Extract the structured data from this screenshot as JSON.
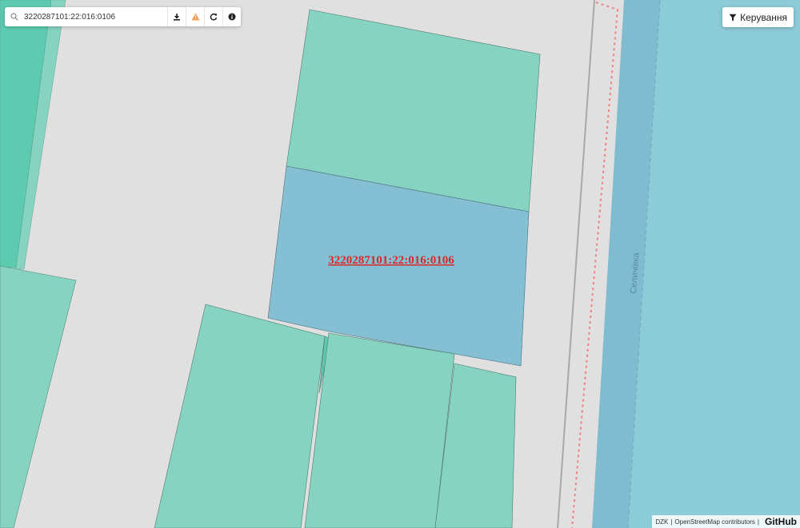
{
  "search": {
    "value": "3220287101:22:016:0106",
    "placeholder": ""
  },
  "toolbar": {
    "download_icon": "download-icon",
    "warning_icon": "warning-icon",
    "refresh_icon": "refresh-icon",
    "info_icon": "info-icon"
  },
  "control": {
    "label": "Керування",
    "icon": "filter-icon"
  },
  "map": {
    "selected_parcel_label": "3220287101:22:016:0106",
    "river_label": "Селичівка",
    "colors": {
      "background": "#e0e0e0",
      "parcel_fill": "#85d3c0",
      "parcel_dark_fill": "#5ccbb0",
      "selected_fill": "#84bfd4",
      "river_fill": "#8ccbd8",
      "river_dark_fill": "#7fbcd0",
      "label_color": "#d9282a",
      "boundary_dash": "#f08080"
    }
  },
  "attribution": {
    "dzk": "DZK",
    "osm": "OpenStreetMap contributors",
    "separator": "|",
    "github": "GitHub"
  }
}
